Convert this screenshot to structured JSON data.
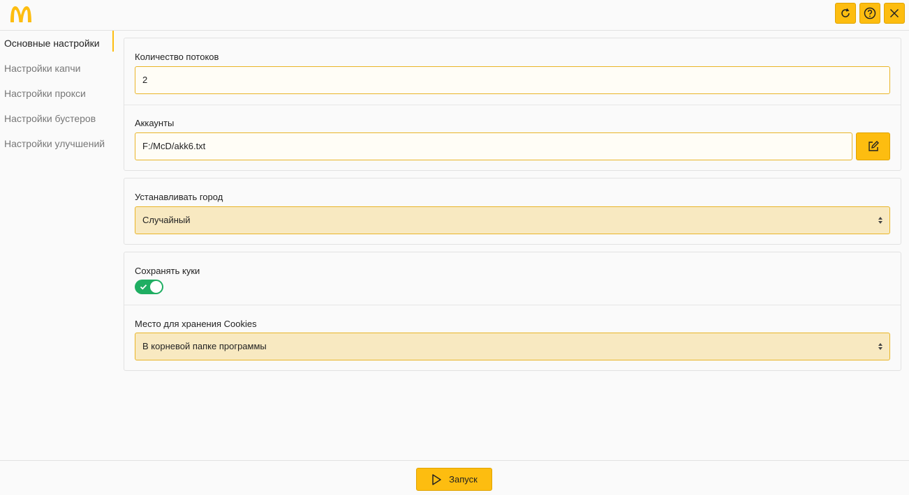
{
  "header": {
    "logo_icon": "mcdonalds-arches-logo",
    "buttons": [
      {
        "icon": "refresh-icon"
      },
      {
        "icon": "help-icon"
      },
      {
        "icon": "close-icon"
      }
    ],
    "accent_color": "#fdbd10"
  },
  "sidebar": {
    "items": [
      {
        "label": "Основные настройки",
        "active": true
      },
      {
        "label": "Настройки капчи",
        "active": false
      },
      {
        "label": "Настройки прокси",
        "active": false
      },
      {
        "label": "Настройки бустеров",
        "active": false
      },
      {
        "label": "Настройки улучшений",
        "active": false
      }
    ]
  },
  "main": {
    "threads": {
      "label": "Количество потоков",
      "value": "2"
    },
    "accounts": {
      "label": "Аккаунты",
      "value": "F:/McD/akk6.txt",
      "edit_icon": "edit-icon"
    },
    "city": {
      "label": "Устанавливать город",
      "selected": "Случайный"
    },
    "cookies": {
      "label": "Сохранять куки",
      "enabled": true,
      "toggle_color": "#1fae62"
    },
    "cookie_location": {
      "label": "Место для хранения Cookies",
      "selected": "В корневой папке программы"
    }
  },
  "footer": {
    "run_label": "Запуск",
    "run_icon": "play-icon"
  }
}
